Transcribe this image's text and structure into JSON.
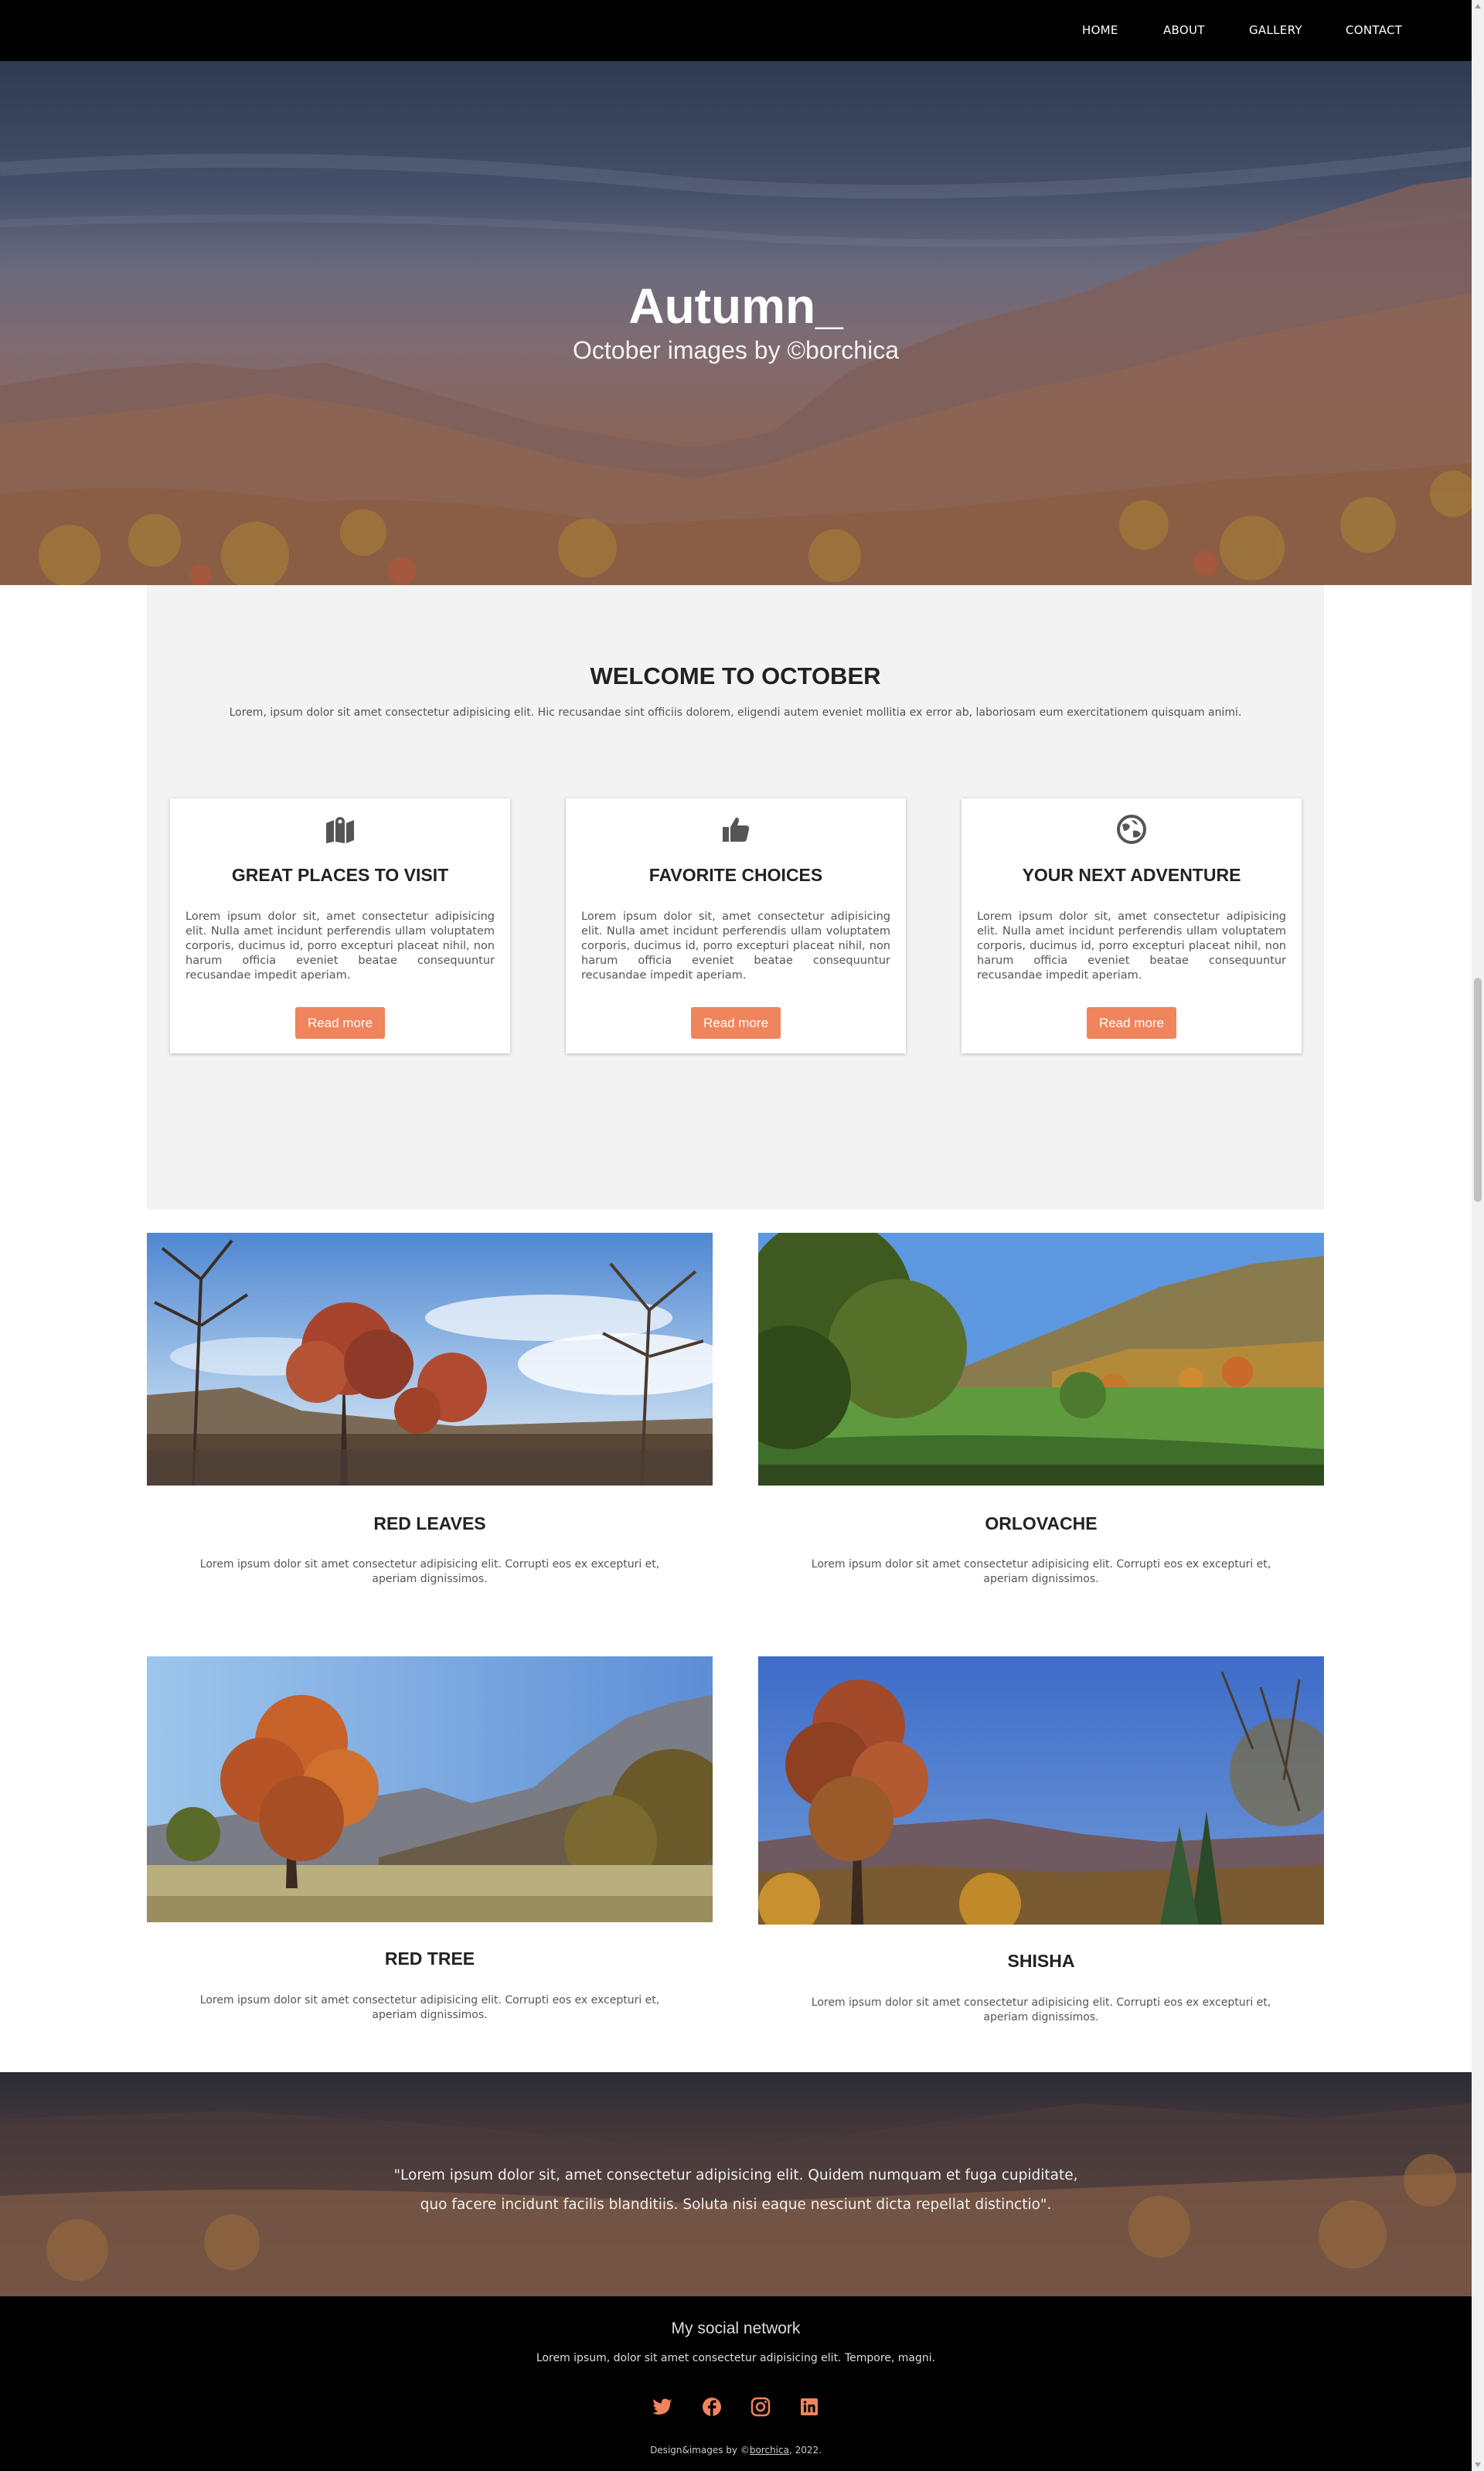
{
  "nav": {
    "items": [
      "HOME",
      "ABOUT",
      "GALLERY",
      "CONTACT"
    ]
  },
  "hero": {
    "title": "Autumn_",
    "subtitle": "October images by ©borchica"
  },
  "welcome": {
    "title": "WELCOME TO OCTOBER",
    "intro": "Lorem, ipsum dolor sit amet consectetur adipisicing elit. Hic recusandae sint officiis dolorem, eligendi autem eveniet mollitia ex error ab, laboriosam eum exercitationem quisquam animi.",
    "cards": [
      {
        "icon": "map-icon",
        "title": "GREAT PLACES TO VISIT",
        "text": "Lorem ipsum dolor sit, amet consectetur adipisicing elit. Nulla amet incidunt perferendis ullam voluptatem corporis, ducimus id, porro excepturi placeat nihil, non harum officia eveniet beatae consequuntur recusandae impedit aperiam.",
        "button": "Read more"
      },
      {
        "icon": "thumbs-up-icon",
        "title": "FAVORITE CHOICES",
        "text": "Lorem ipsum dolor sit, amet consectetur adipisicing elit. Nulla amet incidunt perferendis ullam voluptatem corporis, ducimus id, porro excepturi placeat nihil, non harum officia eveniet beatae consequuntur recusandae impedit aperiam.",
        "button": "Read more"
      },
      {
        "icon": "globe-icon",
        "title": "YOUR NEXT ADVENTURE",
        "text": "Lorem ipsum dolor sit, amet consectetur adipisicing elit. Nulla amet incidunt perferendis ullam voluptatem corporis, ducimus id, porro excepturi placeat nihil, non harum officia eveniet beatae consequuntur recusandae impedit aperiam.",
        "button": "Read more"
      }
    ]
  },
  "gallery": [
    {
      "title": "RED LEAVES",
      "text": "Lorem ipsum dolor sit amet consectetur adipisicing elit. Corrupti eos ex excepturi et, aperiam dignissimos."
    },
    {
      "title": "ORLOVACHE",
      "text": "Lorem ipsum dolor sit amet consectetur adipisicing elit. Corrupti eos ex excepturi et, aperiam dignissimos."
    },
    {
      "title": "RED TREE",
      "text": "Lorem ipsum dolor sit amet consectetur adipisicing elit. Corrupti eos ex excepturi et, aperiam dignissimos."
    },
    {
      "title": "SHISHA",
      "text": "Lorem ipsum dolor sit amet consectetur adipisicing elit. Corrupti eos ex excepturi et, aperiam dignissimos."
    }
  ],
  "quote": {
    "line1": "\"Lorem ipsum dolor sit, amet consectetur adipisicing elit. Quidem numquam et fuga cupiditate,",
    "line2": "quo facere incidunt facilis blanditiis. Soluta nisi eaque nesciunt dicta repellat distinctio\"."
  },
  "footer": {
    "title": "My social network",
    "desc": "Lorem ipsum, dolor sit amet consectetur adipisicing elit. Tempore, magni.",
    "social": [
      "twitter-icon",
      "facebook-icon",
      "instagram-icon",
      "linkedin-icon"
    ],
    "credit_prefix": "Design&images by ©",
    "credit_link": "borchica",
    "credit_suffix": ", 2022."
  },
  "colors": {
    "accent": "#f0845c",
    "nav_bg": "#000000",
    "section_bg": "#f3f3f3",
    "icon": "#555555"
  }
}
